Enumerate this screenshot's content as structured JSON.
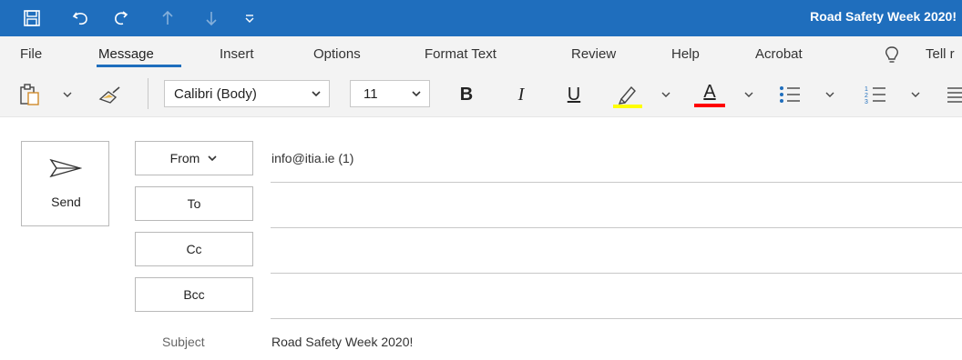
{
  "window": {
    "title": "Road Safety Week 2020!"
  },
  "quick_access": {
    "icons": [
      "save-icon",
      "undo-icon",
      "redo-icon",
      "previous-item-icon",
      "next-item-icon",
      "customize-toolbar-icon"
    ]
  },
  "tabs": [
    "File",
    "Message",
    "Insert",
    "Options",
    "Format Text",
    "Review",
    "Help",
    "Acrobat",
    "Tell r"
  ],
  "active_tab": "Message",
  "toolbar": {
    "font_name": "Calibri (Body)",
    "font_size": "11",
    "bold_label": "B",
    "italic_label": "I",
    "underline_label": "U",
    "font_color_label": "A",
    "highlight_color": "#ffff00",
    "font_color": "#ff0000"
  },
  "compose": {
    "send_label": "Send",
    "from_label": "From",
    "from_value": "info@itia.ie (1)",
    "to_label": "To",
    "to_value": "",
    "cc_label": "Cc",
    "cc_value": "",
    "bcc_label": "Bcc",
    "bcc_value": "",
    "subject_label": "Subject",
    "subject_value": "Road Safety Week 2020!"
  },
  "colors": {
    "accent": "#1f6ebd"
  }
}
